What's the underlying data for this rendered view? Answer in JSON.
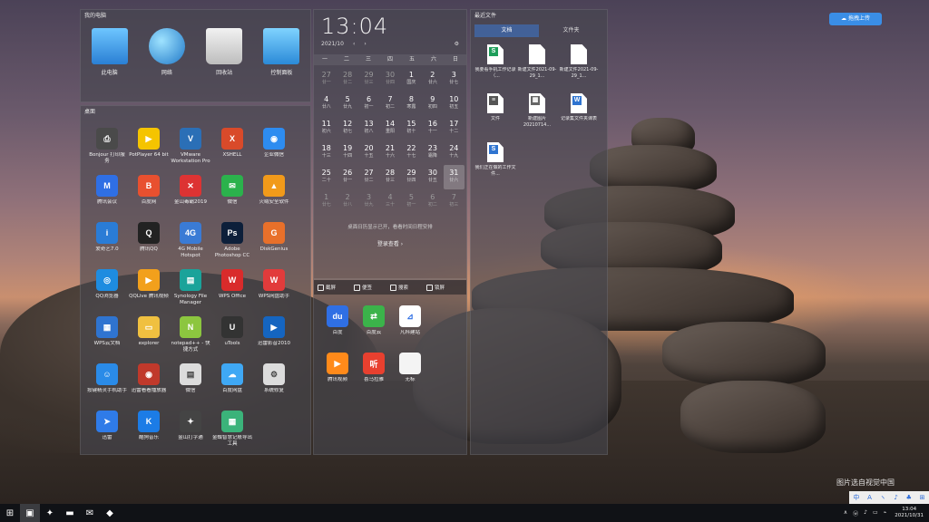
{
  "colors": {
    "accent": "#3a8ee6",
    "panel": "#46464e",
    "taskbar": "#101216"
  },
  "computer": {
    "title": "我的电脑",
    "items": [
      {
        "label": "此电脑",
        "icon": "computer-icon"
      },
      {
        "label": "网络",
        "icon": "network-globe-icon"
      },
      {
        "label": "回收站",
        "icon": "recycle-bin-icon"
      },
      {
        "label": "控制面板",
        "icon": "control-panel-icon"
      }
    ]
  },
  "desktop": {
    "title": "桌面",
    "apps": [
      {
        "label": "Bonjour 打印服务",
        "icon": "printer-icon",
        "color": "#4a4a4a",
        "glyph": "⎙"
      },
      {
        "label": "PotPlayer 64 bit",
        "icon": "potplayer-icon",
        "color": "#f5c400",
        "glyph": "▶"
      },
      {
        "label": "VMware Workstation Pro",
        "icon": "vmware-icon",
        "color": "#2b6fb6",
        "glyph": "V"
      },
      {
        "label": "XSHELL",
        "icon": "xshell-icon",
        "color": "#d94a2a",
        "glyph": "X"
      },
      {
        "label": "企业微信",
        "icon": "wecom-icon",
        "color": "#2d8cf0",
        "glyph": "◉"
      },
      {
        "label": "腾讯会议",
        "icon": "tencent-meeting-icon",
        "color": "#2f6fe4",
        "glyph": "M"
      },
      {
        "label": "百度网",
        "icon": "baidu-icon",
        "color": "#e8502f",
        "glyph": "B"
      },
      {
        "label": "金山毒霸2019",
        "icon": "duba-icon",
        "color": "#d33",
        "glyph": "✕"
      },
      {
        "label": "微信",
        "icon": "wechat-icon",
        "color": "#2bb24c",
        "glyph": "✉"
      },
      {
        "label": "火绒安全软件",
        "icon": "huorong-icon",
        "color": "#f19a1a",
        "glyph": "▲"
      },
      {
        "label": "爱奇艺7.0",
        "icon": "iqiyi-icon",
        "color": "#2a7cd6",
        "glyph": "i"
      },
      {
        "label": "腾讯QQ",
        "icon": "qq-icon",
        "color": "#222",
        "glyph": "Q"
      },
      {
        "label": "4G Mobile Hotspot",
        "icon": "hotspot-icon",
        "color": "#3a7bd5",
        "glyph": "4G"
      },
      {
        "label": "Adobe Photoshop CC",
        "icon": "photoshop-icon",
        "color": "#0d1f3a",
        "glyph": "Ps"
      },
      {
        "label": "DiskGenius",
        "icon": "diskgenius-icon",
        "color": "#e8702a",
        "glyph": "G"
      },
      {
        "label": "QQ浏览器",
        "icon": "qq-browser-icon",
        "color": "#1e8ce0",
        "glyph": "◎"
      },
      {
        "label": "QQLive 腾讯视频",
        "icon": "tencent-video-icon",
        "color": "#f2a01c",
        "glyph": "▶"
      },
      {
        "label": "Synology File Manager",
        "icon": "synology-icon",
        "color": "#1aa39a",
        "glyph": "▤"
      },
      {
        "label": "WPS Office",
        "icon": "wps-office-icon",
        "color": "#d92b2b",
        "glyph": "W"
      },
      {
        "label": "WPS网盘助手",
        "icon": "wps-cloud-icon",
        "color": "#e23b3b",
        "glyph": "W"
      },
      {
        "label": "WPS云文档",
        "icon": "wps-doc-icon",
        "color": "#2f74d0",
        "glyph": "▦"
      },
      {
        "label": "explorer",
        "icon": "explorer-icon",
        "color": "#f0c040",
        "glyph": "▭"
      },
      {
        "label": "notepad++ - 快捷方式",
        "icon": "notepadpp-icon",
        "color": "#8cc63f",
        "glyph": "N"
      },
      {
        "label": "uTools",
        "icon": "utools-icon",
        "color": "#333",
        "glyph": "U"
      },
      {
        "label": "迅雷影音2010",
        "icon": "player-icon",
        "color": "#1565c0",
        "glyph": "▶"
      },
      {
        "label": "按键精灵手机助手",
        "icon": "assistant-icon",
        "color": "#2a8be8",
        "glyph": "☺"
      },
      {
        "label": "迅雷看看播放器",
        "icon": "kankan-icon",
        "color": "#c0392b",
        "glyph": "◉"
      },
      {
        "label": "微信",
        "icon": "wechat-file-icon",
        "color": "#dcdcdc",
        "glyph": "▤"
      },
      {
        "label": "百度网盘",
        "icon": "baidu-netdisk-icon",
        "color": "#3fa8f4",
        "glyph": "☁"
      },
      {
        "label": "系统修复",
        "icon": "system-repair-icon",
        "color": "#dcdcdc",
        "glyph": "⚙"
      },
      {
        "label": "迅雷",
        "icon": "thunder-icon",
        "color": "#2f7be8",
        "glyph": "➤"
      },
      {
        "label": "酷狗音乐",
        "icon": "kugou-icon",
        "color": "#1c7ce6",
        "glyph": "K"
      },
      {
        "label": "金山打字通",
        "icon": "typing-icon",
        "color": "#444",
        "glyph": "✦"
      },
      {
        "label": "金蝶智慧记账导出工具",
        "icon": "accounting-icon",
        "color": "#3bb37a",
        "glyph": "▦"
      }
    ]
  },
  "calendar": {
    "time": "13:04",
    "month": "2021/10",
    "weekdays": [
      "一",
      "二",
      "三",
      "四",
      "五",
      "六",
      "日"
    ],
    "days": [
      {
        "n": "27",
        "l": "廿一",
        "dim": true
      },
      {
        "n": "28",
        "l": "廿二",
        "dim": true
      },
      {
        "n": "29",
        "l": "廿三",
        "dim": true
      },
      {
        "n": "30",
        "l": "廿四",
        "dim": true
      },
      {
        "n": "1",
        "l": "国庆"
      },
      {
        "n": "2",
        "l": "廿六"
      },
      {
        "n": "3",
        "l": "廿七"
      },
      {
        "n": "4",
        "l": "廿八"
      },
      {
        "n": "5",
        "l": "廿九"
      },
      {
        "n": "6",
        "l": "初一"
      },
      {
        "n": "7",
        "l": "初二"
      },
      {
        "n": "8",
        "l": "寒露"
      },
      {
        "n": "9",
        "l": "初四"
      },
      {
        "n": "10",
        "l": "初五"
      },
      {
        "n": "11",
        "l": "初六"
      },
      {
        "n": "12",
        "l": "初七"
      },
      {
        "n": "13",
        "l": "初八"
      },
      {
        "n": "14",
        "l": "重阳"
      },
      {
        "n": "15",
        "l": "初十"
      },
      {
        "n": "16",
        "l": "十一"
      },
      {
        "n": "17",
        "l": "十二"
      },
      {
        "n": "18",
        "l": "十三"
      },
      {
        "n": "19",
        "l": "十四"
      },
      {
        "n": "20",
        "l": "十五"
      },
      {
        "n": "21",
        "l": "十六"
      },
      {
        "n": "22",
        "l": "十七"
      },
      {
        "n": "23",
        "l": "霜降"
      },
      {
        "n": "24",
        "l": "十九"
      },
      {
        "n": "25",
        "l": "二十"
      },
      {
        "n": "26",
        "l": "廿一"
      },
      {
        "n": "27",
        "l": "廿二"
      },
      {
        "n": "28",
        "l": "廿三"
      },
      {
        "n": "29",
        "l": "廿四"
      },
      {
        "n": "30",
        "l": "廿五"
      },
      {
        "n": "31",
        "l": "廿六",
        "today": true
      },
      {
        "n": "1",
        "l": "廿七",
        "dim": true
      },
      {
        "n": "2",
        "l": "廿八",
        "dim": true
      },
      {
        "n": "3",
        "l": "廿九",
        "dim": true
      },
      {
        "n": "4",
        "l": "三十",
        "dim": true
      },
      {
        "n": "5",
        "l": "初一",
        "dim": true
      },
      {
        "n": "6",
        "l": "初二",
        "dim": true
      },
      {
        "n": "7",
        "l": "初三",
        "dim": true
      }
    ],
    "note": "桌面日历显示已开，看看时间日程安排",
    "login": "登录查看 ›"
  },
  "quick": {
    "bar": [
      "截屏",
      "便签",
      "搜索",
      "锁屏"
    ],
    "apps": [
      {
        "label": "百度",
        "icon": "baidu-paw-icon",
        "color": "#2f6fe4",
        "glyph": "du"
      },
      {
        "label": "百度云",
        "icon": "transfer-icon",
        "color": "#3bb34a",
        "glyph": "⇄"
      },
      {
        "label": "凡科建站",
        "icon": "fanke-icon",
        "color": "#ffffff",
        "glyph": "⊿"
      },
      {
        "label": "",
        "icon": "",
        "color": "transparent",
        "glyph": ""
      },
      {
        "label": "腾讯视频",
        "icon": "tencent-video-play-icon",
        "color": "#ff8a1a",
        "glyph": "▶"
      },
      {
        "label": "喜马拉雅",
        "icon": "ximalaya-icon",
        "color": "#e8402f",
        "glyph": "听"
      },
      {
        "label": "无标",
        "icon": "blank-file-icon",
        "color": "#f4f4f4",
        "glyph": ""
      }
    ]
  },
  "recent": {
    "title": "最近文件",
    "tabs": [
      "文档",
      "文件夹"
    ],
    "files": [
      {
        "label": "我要看手机工作记录（...",
        "type": "sheet",
        "badge": "S",
        "color": "#1e9e5a"
      },
      {
        "label": "新建文件2021-09-29_1...",
        "type": "blank",
        "badge": "",
        "color": ""
      },
      {
        "label": "新建文件2021-09-29_1...",
        "type": "blank",
        "badge": "",
        "color": ""
      },
      {
        "label": "文件",
        "type": "text",
        "badge": "≡",
        "color": "#555"
      },
      {
        "label": "新建图片20210714...",
        "type": "image",
        "badge": "▦",
        "color": "#666"
      },
      {
        "label": "记录集文件夹课表",
        "type": "word",
        "badge": "W",
        "color": "#2f74d0"
      },
      {
        "label": "我们正在做的工作文件...",
        "type": "sheet",
        "badge": "S",
        "color": "#2f74d0"
      }
    ]
  },
  "upload_button": "拖拽上传",
  "watermark": "图片选自视觉中国",
  "tray_strip": [
    "中",
    "A",
    "ヽ",
    "♪",
    "♣",
    "⊞"
  ],
  "taskbar": {
    "items": [
      {
        "name": "start-icon",
        "glyph": "⊞",
        "active": false
      },
      {
        "name": "wps-taskbar-icon",
        "glyph": "▣",
        "active": true
      },
      {
        "name": "puzzle-taskbar-icon",
        "glyph": "✦",
        "active": false
      },
      {
        "name": "folder-taskbar-icon",
        "glyph": "▬",
        "active": false
      },
      {
        "name": "wechat-taskbar-icon",
        "glyph": "✉",
        "active": false
      },
      {
        "name": "app-taskbar-icon",
        "glyph": "◆",
        "active": false
      }
    ],
    "tray": [
      "∧",
      "ⓦ",
      "♪",
      "▭",
      "⌁"
    ],
    "time": "13:04",
    "date": "2021/10/31"
  }
}
